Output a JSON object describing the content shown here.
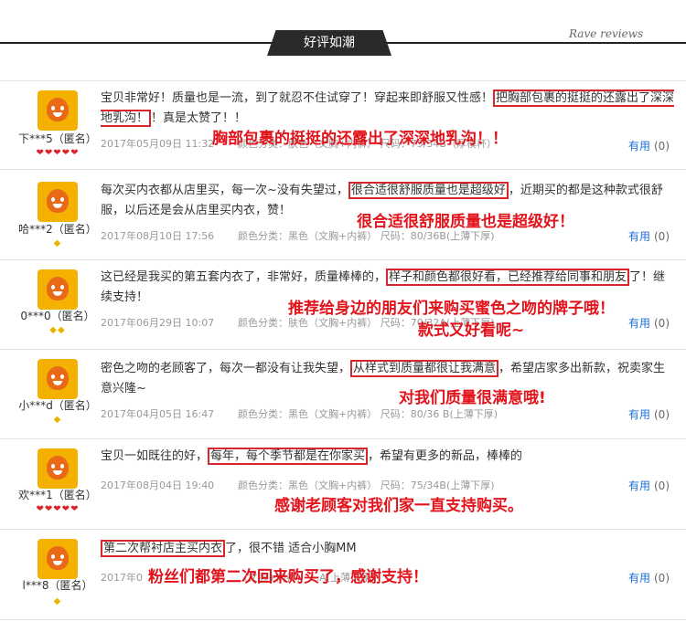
{
  "header": {
    "title": "好评如潮",
    "subtitle": "Rave reviews"
  },
  "reviews": [
    {
      "user": "下***5（匿名）",
      "badges": "❤❤❤❤❤",
      "text_before": "宝贝非常好！质量也是一流，到了就忍不住试穿了！穿起来即舒服又性感！",
      "highlight": "把胸部包裹的挺挺的还露出了深深地乳沟！",
      "text_after": "！真是太赞了！！",
      "date": "2017年05月09日 11:32",
      "specs": "颜色分类：肤色（文胸+内裤）  尺码：75/34B（厚模杯）",
      "useful_label": "有用",
      "useful_count": "(0)",
      "overlay": "胸部包裹的挺挺的还露出了深深地乳沟！！"
    },
    {
      "user": "哈***2（匿名）",
      "badges": "◆",
      "text_before": "每次买内衣都从店里买，每一次~没有失望过，",
      "highlight": "很合适很舒服质量也是超级好",
      "text_after": "，近期买的都是这种款式很舒服，以后还是会从店里买内衣，赞！",
      "date": "2017年08月10日 17:56",
      "specs": "颜色分类：黑色（文胸+内裤）  尺码：80/36B(上薄下厚)",
      "useful_label": "有用",
      "useful_count": "(0)",
      "overlay": "很合适很舒服质量也是超级好！"
    },
    {
      "user": "0***0（匿名）",
      "badges": "◆◆",
      "text_before": "这已经是我买的第五套内衣了，非常好，质量棒棒的，",
      "highlight": "样子和颜色都很好看，已经推荐给同事和朋友",
      "text_after": "了！继续支持！",
      "date": "2017年06月29日 10:07",
      "specs": "颜色分类：肤色（文胸+内裤）  尺码：70/32A(上薄下厚)",
      "useful_label": "有用",
      "useful_count": "(0)",
      "overlay": "推荐给身边的朋友们来购买蜜色之吻的牌子哦！",
      "overlay2": "款式又好看呢~"
    },
    {
      "user": "小***d（匿名）",
      "badges": "◆",
      "text_before": "密色之吻的老顾客了，每次一都没有让我失望，",
      "highlight": "从样式到质量都很让我满意",
      "text_after": "，希望店家多出新款，祝卖家生意兴隆~",
      "date": "2017年04月05日 16:47",
      "specs": "颜色分类：黑色（文胸+内裤）  尺码：80/36 B(上薄下厚)",
      "useful_label": "有用",
      "useful_count": "(0)",
      "overlay": "对我们质量很满意哦!"
    },
    {
      "user": "欢***1（匿名）",
      "badges": "❤❤❤❤❤",
      "text_before": "宝贝一如既往的好，",
      "highlight": "每年，每个季节都是在你家买",
      "text_after": "，希望有更多的新品，棒棒的",
      "date": "2017年08月04日 19:40",
      "specs": "颜色分类：黑色（文胸+内裤）  尺码：75/34B(上薄下厚)",
      "useful_label": "有用",
      "useful_count": "(0)",
      "overlay": "感谢老顾客对我们家一直支持购买。"
    },
    {
      "user": "l***8（匿名）",
      "badges": "◆",
      "text_before": "",
      "highlight": "第二次帮衬店主买内衣",
      "text_after": "了，很不错 适合小胸MM",
      "date": "2017年0",
      "specs": "（文胸+内裤）   ...A(上薄下厚)",
      "useful_label": "有用",
      "useful_count": "(0)",
      "overlay": "粉丝们都第二次回来购买了，感谢支持！"
    }
  ]
}
